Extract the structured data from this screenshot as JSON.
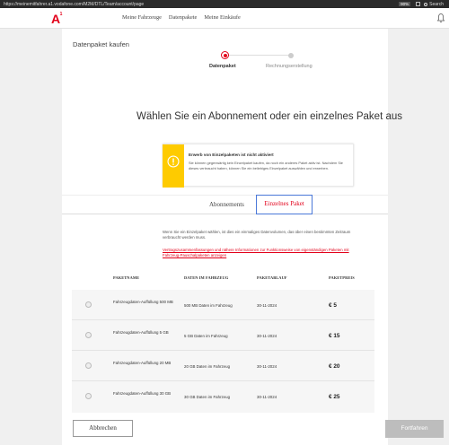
{
  "browser": {
    "url": "https://meinemitfahrer.a1.vodafone.com/M2M/DTL/Team/account/page",
    "zoom": "90%",
    "search_label": "Search"
  },
  "nav": {
    "logo_text": "A",
    "logo_sup": "1",
    "links": [
      "Meine Fahrzeuge",
      "Datenpakete",
      "Meine Einkäufe"
    ]
  },
  "page": {
    "title": "Datenpaket kaufen",
    "steps": [
      "Datenpaket",
      "Rechnungserstellung"
    ],
    "headline": "Wählen Sie ein Abonnement oder ein einzelnes Paket aus"
  },
  "alert": {
    "title": "Erwerb von Einzelpaketen ist nicht aktiviert",
    "body": "Sie können gegenwärtig kein Einzelpaket kaufen, da noch ein anderes Paket aktiv ist. Nachdem Sie dieses verbraucht haben, können Sie ein beliebiges Einzelpaket auswählen und erwerben."
  },
  "tabs": {
    "abonnements": "Abonnements",
    "einzelnes": "Einzelnes Paket"
  },
  "info": {
    "text": "Wenn Sie ein Einzelpaket wählen, ist dies ein einmaliges Datenvolumen, das über einen bestimmten Zeitraum verbraucht werden muss.",
    "link": "Vertragszusammenfassungen und nähere Informationen zur Funktionsweise von eigenständigen Paketen mit Fahrzeug-Pauschalpaketen anzeigen"
  },
  "table": {
    "headers": [
      "PAKETNAME",
      "DATEN IM FAHRZEUG",
      "PAKETABLAUF",
      "PAKETPREIS"
    ],
    "rows": [
      {
        "name": "Fahrzeugdaten-Auffüllung 500 MB",
        "data": "500 MB Daten im Fahrzeug",
        "expiry": "30-11-2024",
        "price": "€ 5"
      },
      {
        "name": "Fahrzeugdaten-Auffüllung 5 GB",
        "data": "5 GB Daten im Fahrzeug",
        "expiry": "30-11-2024",
        "price": "€ 15"
      },
      {
        "name": "Fahrzeugdaten-Auffüllung 20 MB",
        "data": "20 GB Daten im Fahrzeug",
        "expiry": "30-11-2024",
        "price": "€ 20"
      },
      {
        "name": "Fahrzeugdaten-Auffüllung 30 GB",
        "data": "30 GB Daten im Fahrzeug",
        "expiry": "30-11-2024",
        "price": "€ 25"
      }
    ]
  },
  "buttons": {
    "cancel": "Abbrechen",
    "next": "Fortfahren"
  },
  "colors": {
    "brand_red": "#e2001a",
    "alert_yellow": "#fecb00",
    "tab_focus_blue": "#4a78d8",
    "disabled_gray": "#bdbdbd"
  }
}
